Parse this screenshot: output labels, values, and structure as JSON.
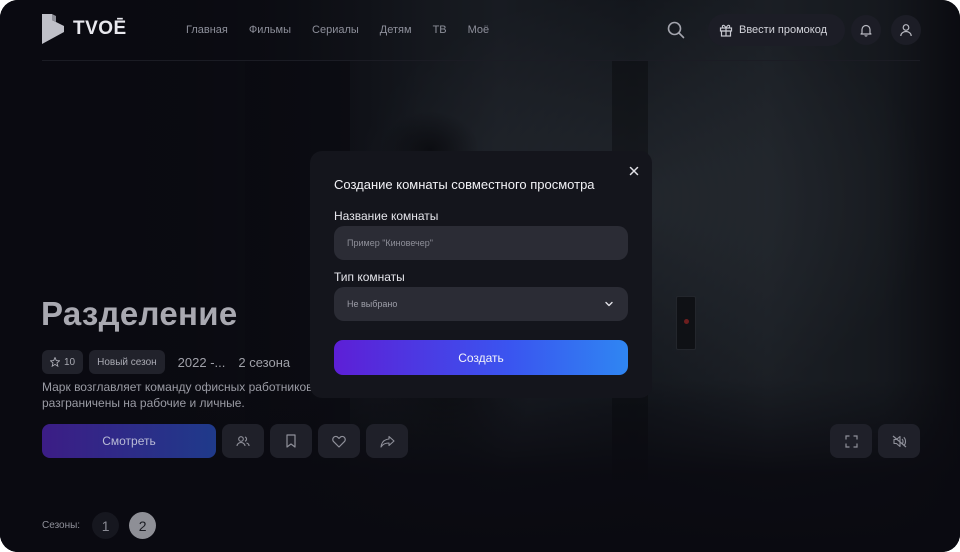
{
  "header": {
    "logo_text": "TVOĒ",
    "nav": [
      "Главная",
      "Фильмы",
      "Сериалы",
      "Детям",
      "ТВ",
      "Моё"
    ],
    "promo_label": "Ввести промокод",
    "icons": [
      "search-icon",
      "gift-icon",
      "bell-icon",
      "user-icon"
    ]
  },
  "hero": {
    "title": "Разделение",
    "rating": "10",
    "badge": "Новый сезон",
    "years": "2022 -...",
    "seasons_count": "2 сезона",
    "description": "Марк возглавляет команду офисных работников, воспоминания которых разграничены на рабочие и личные.",
    "watch_label": "Смотреть",
    "action_icons": [
      "watch-together-icon",
      "bookmark-icon",
      "heart-icon",
      "share-icon"
    ],
    "right_icons": [
      "fullscreen-icon",
      "mute-icon"
    ]
  },
  "seasons": {
    "label": "Сезоны:",
    "items": [
      "1",
      "2"
    ],
    "active": "2"
  },
  "modal": {
    "title": "Создание комнаты совместного просмотра",
    "name_label": "Название комнаты",
    "name_placeholder": "Пример \"Киновечер\"",
    "name_value": "",
    "type_label": "Тип комнаты",
    "type_value": "Не выбрано",
    "create_label": "Создать"
  },
  "colors": {
    "background": "#0c0c14",
    "modal": "#14151c",
    "accent_start": "#5d1fd6",
    "accent_end": "#2f86f2"
  }
}
